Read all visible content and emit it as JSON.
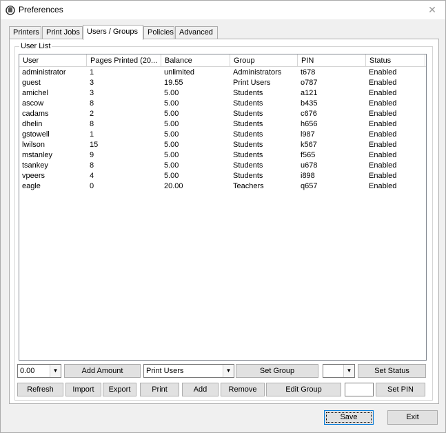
{
  "window": {
    "title": "Preferences"
  },
  "tabs": [
    {
      "label": "Printers"
    },
    {
      "label": "Print Jobs"
    },
    {
      "label": "Users / Groups"
    },
    {
      "label": "Policies"
    },
    {
      "label": "Advanced"
    }
  ],
  "active_tab": "Users / Groups",
  "user_list": {
    "group_label": "User List",
    "columns": [
      "User",
      "Pages Printed (20...",
      "Balance",
      "Group",
      "PIN",
      "Status"
    ],
    "rows": [
      [
        "administrator",
        "1",
        "unlimited",
        "Administrators",
        "t678",
        "Enabled"
      ],
      [
        "guest",
        "3",
        "19.55",
        "Print Users",
        "o787",
        "Enabled"
      ],
      [
        "amichel",
        "3",
        "5.00",
        "Students",
        "a121",
        "Enabled"
      ],
      [
        "ascow",
        "8",
        "5.00",
        "Students",
        "b435",
        "Enabled"
      ],
      [
        "cadams",
        "2",
        "5.00",
        "Students",
        "c676",
        "Enabled"
      ],
      [
        "dhelin",
        "8",
        "5.00",
        "Students",
        "h656",
        "Enabled"
      ],
      [
        "gstowell",
        "1",
        "5.00",
        "Students",
        "l987",
        "Enabled"
      ],
      [
        "lwilson",
        "15",
        "5.00",
        "Students",
        "k567",
        "Enabled"
      ],
      [
        "mstanley",
        "9",
        "5.00",
        "Students",
        "f565",
        "Enabled"
      ],
      [
        "tsankey",
        "8",
        "5.00",
        "Students",
        "u678",
        "Enabled"
      ],
      [
        "vpeers",
        "4",
        "5.00",
        "Students",
        "i898",
        "Enabled"
      ],
      [
        "eagle",
        "0",
        "20.00",
        "Teachers",
        "q657",
        "Enabled"
      ]
    ]
  },
  "controls": {
    "amount_value": "0.00",
    "add_amount_label": "Add Amount",
    "group_value": "Print Users",
    "set_group_label": "Set Group",
    "status_value": "",
    "set_status_label": "Set Status",
    "refresh_label": "Refresh",
    "import_label": "Import",
    "export_label": "Export",
    "print_label": "Print",
    "add_label": "Add",
    "remove_label": "Remove",
    "edit_group_label": "Edit Group",
    "pin_value": "",
    "set_pin_label": "Set PIN"
  },
  "footer": {
    "save_label": "Save",
    "exit_label": "Exit"
  },
  "icons": {
    "app": "printer-gear-icon",
    "close": "close-icon",
    "dropdown": "chevron-down-icon"
  }
}
